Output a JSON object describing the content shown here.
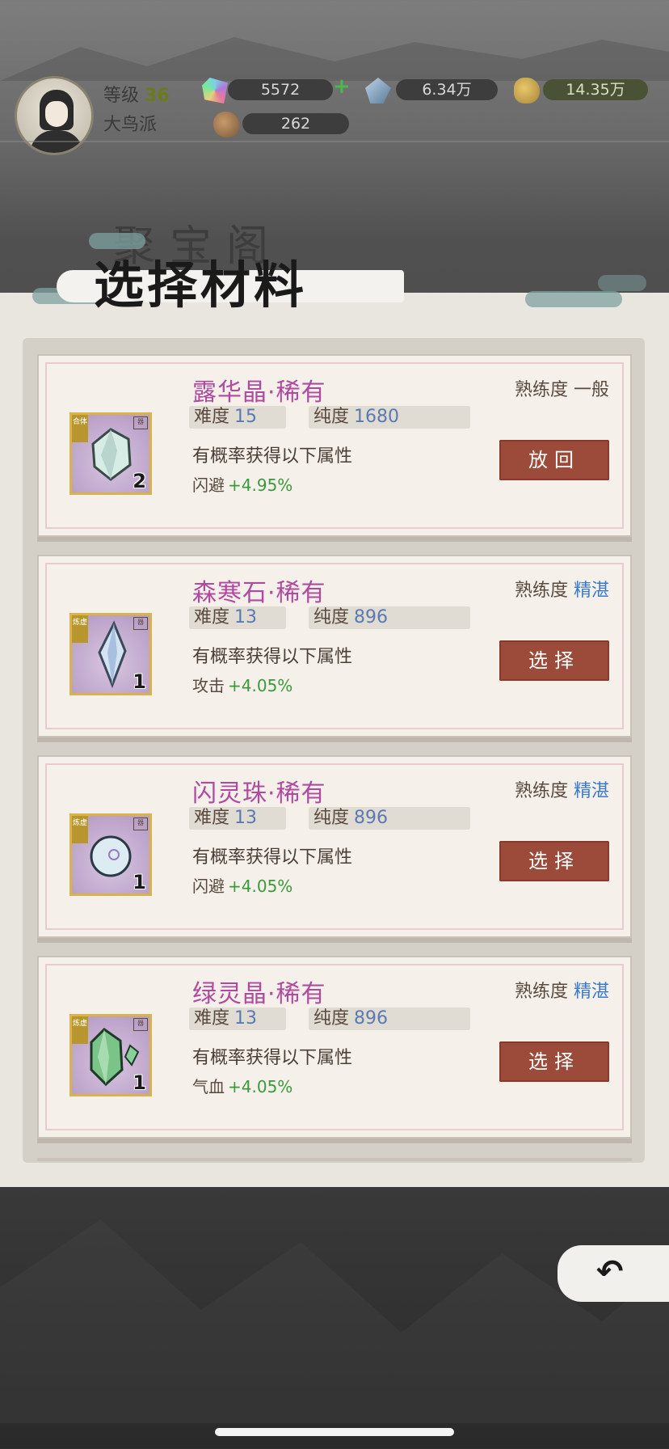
{
  "player": {
    "level_label": "等级",
    "level": "36",
    "sect": "大鸟派"
  },
  "resources": [
    {
      "name": "spirit-stone",
      "icon": "rainbow-gem-icon",
      "value": "5572",
      "has_plus": true
    },
    {
      "name": "crystal",
      "icon": "blue-gem-icon",
      "value": "6.34万"
    },
    {
      "name": "gold",
      "icon": "gold-nugget-icon",
      "value": "14.35万"
    },
    {
      "name": "ore",
      "icon": "ore-icon",
      "value": "262"
    }
  ],
  "panel": {
    "title": "选择材料",
    "background_title": "聚宝阁"
  },
  "labels": {
    "difficulty": "难度",
    "purity": "纯度",
    "proficiency": "熟练度",
    "desc": "有概率获得以下属性"
  },
  "materials": [
    {
      "name": "露华晶·稀有",
      "proficiency": "一般",
      "difficulty": "15",
      "purity": "1680",
      "attr_name": "闪避",
      "attr_value": "+4.95%",
      "quantity": "2",
      "tag": "合体",
      "button": "放回",
      "gem_color": "#cfe0dc"
    },
    {
      "name": "森寒石·稀有",
      "proficiency": "精湛",
      "difficulty": "13",
      "purity": "896",
      "attr_name": "攻击",
      "attr_value": "+4.05%",
      "quantity": "1",
      "tag": "炼虚",
      "button": "选择",
      "gem_color": "#c4d4ec"
    },
    {
      "name": "闪灵珠·稀有",
      "proficiency": "精湛",
      "difficulty": "13",
      "purity": "896",
      "attr_name": "闪避",
      "attr_value": "+4.05%",
      "quantity": "1",
      "tag": "炼虚",
      "button": "选择",
      "gem_color": "#d0e4ec"
    },
    {
      "name": "绿灵晶·稀有",
      "proficiency": "精湛",
      "difficulty": "13",
      "purity": "896",
      "attr_name": "气血",
      "attr_value": "+4.05%",
      "quantity": "1",
      "tag": "炼虚",
      "button": "选择",
      "gem_color": "#6ab87a"
    }
  ],
  "colors": {
    "button": "#9c4a3a",
    "name": "#b04aa0",
    "proficiency_high": "#3a7ac8",
    "attr_value": "#3a9a3a"
  }
}
